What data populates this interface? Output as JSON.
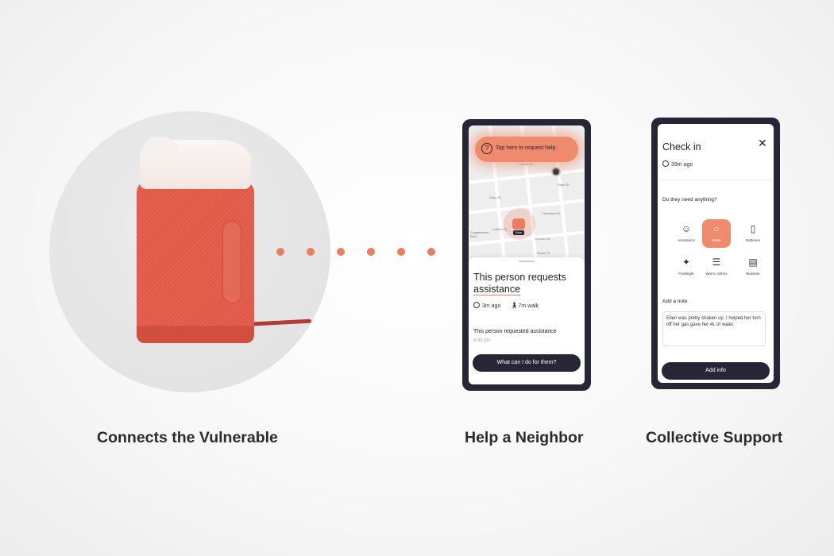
{
  "colors": {
    "accent": "#ec7d60",
    "dark": "#272637",
    "device": "#e0604e"
  },
  "device": {
    "icon": "home-hub-device"
  },
  "help_screen": {
    "request_button": "Tap here to request help.",
    "streets": [
      "Pacific St.",
      "Dean St.",
      "Dean St.",
      "Lefferts St.",
      "Greene St.",
      "Cleveland St.",
      "Dowel St.",
      "Guggenheim Blvd"
    ],
    "pin_tag": "Now",
    "sheet_title_prefix": "This person requests",
    "sheet_title_highlight": "assistance",
    "time_ago": "3m ago",
    "walk": "7m walk",
    "request_title": "This person requested assistance",
    "request_time": "4:45 pm",
    "action_button": "What can I do for them?"
  },
  "checkin_screen": {
    "title": "Check in",
    "time_ago": "39m ago",
    "question": "Do they need anything?",
    "options": [
      {
        "label": "Assistance",
        "icon": "smiley-icon",
        "selected": false
      },
      {
        "label": "Water",
        "icon": "water-drop-icon",
        "selected": true
      },
      {
        "label": "Batteries",
        "icon": "battery-icon",
        "selected": false
      },
      {
        "label": "Flashlight",
        "icon": "flashlight-icon",
        "selected": false
      },
      {
        "label": "Warm clothes",
        "icon": "shirt-icon",
        "selected": false
      },
      {
        "label": "Blankets",
        "icon": "blanket-icon",
        "selected": false
      }
    ],
    "note_label": "Add a note",
    "note_text": "Ellen was pretty shaken up. I helped her turn off her gas gave her 4L of water.",
    "submit_button": "Add info"
  },
  "captions": [
    "Connects the Vulnerable",
    "Help a Neighbor",
    "Collective Support"
  ]
}
